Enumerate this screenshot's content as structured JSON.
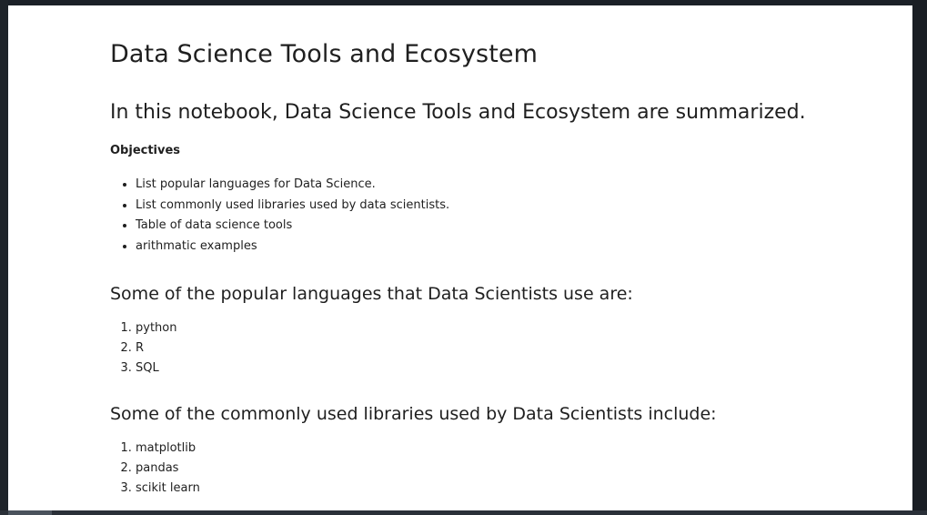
{
  "notebook": {
    "title": "Data Science Tools and Ecosystem",
    "intro": "In this notebook, Data Science Tools and Ecosystem are summarized.",
    "objectives": {
      "heading": "Objectives",
      "items": [
        "List popular languages for Data Science.",
        "List commonly used libraries used by data scientists.",
        "Table of data science tools",
        "arithmatic examples"
      ]
    },
    "languages": {
      "heading": "Some of the popular languages that Data Scientists use are:",
      "items": [
        "python",
        "R",
        "SQL"
      ]
    },
    "libraries": {
      "heading": "Some of the commonly used libraries used by Data Scientists include:",
      "items": [
        "matplotlib",
        "pandas",
        "scikit learn"
      ]
    }
  },
  "colors": {
    "page_background": "#ffffff",
    "frame": "#1b2027",
    "text": "#1f1f1f"
  }
}
